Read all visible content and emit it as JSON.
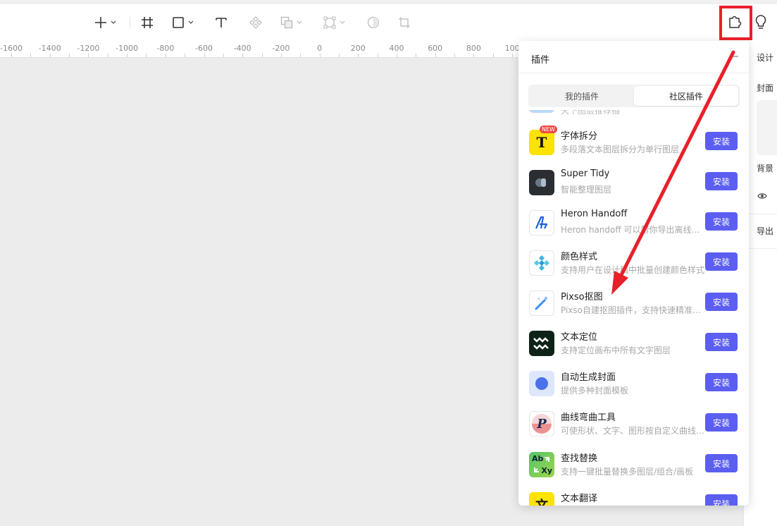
{
  "toolbar": {
    "tools": [
      "add-tool",
      "frame-tool",
      "shape-tool",
      "text-tool",
      "component-tool",
      "boolean-tool",
      "vector-tool",
      "mask-tool",
      "crop-tool"
    ],
    "plugin_icon": "puzzle-icon",
    "hint_icon": "lightbulb-icon"
  },
  "ruler": {
    "labels": [
      "-1600",
      "-1400",
      "-1200",
      "-1000",
      "-800",
      "-600",
      "-400",
      "-200",
      "0",
      "200",
      "400",
      "600",
      "800",
      "100"
    ]
  },
  "design_panel": {
    "design": "设计",
    "cover": "封面",
    "background": "背景",
    "export": "导出"
  },
  "plugin_panel": {
    "title": "插件",
    "tabs": {
      "mine": "我的插件",
      "community": "社区插件"
    },
    "partial_desc": "天下图层推荐插",
    "install_label": "安装",
    "new_badge": "NEW",
    "plugins": [
      {
        "name": "字体拆分",
        "desc": "多段落文本图层拆分为单行图层"
      },
      {
        "name": "Super Tidy",
        "desc": "智能整理图层"
      },
      {
        "name": "Heron Handoff",
        "desc": "Heron handoff 可以帮你导出离线标注"
      },
      {
        "name": "颜色样式",
        "desc": "支持用户在设计稿中批量创建颜色样式"
      },
      {
        "name": "Pixso抠图",
        "desc": "Pixso自建抠图插件，支持快速精准抠图"
      },
      {
        "name": "文本定位",
        "desc": "支持定位画布中所有文字图层"
      },
      {
        "name": "自动生成封面",
        "desc": "提供多种封面模板"
      },
      {
        "name": "曲线弯曲工具",
        "desc": "可使形状、文字、图形按自定义曲线弯曲"
      },
      {
        "name": "查找替换",
        "desc": "支持一键批量替换多图层/组合/画板"
      },
      {
        "name": "文本翻译",
        "desc": ""
      }
    ]
  },
  "icon_labels": {
    "font_split": "T",
    "find_replace_ab": "Ab",
    "find_replace_xy": "Xy",
    "curve": "P",
    "translate": "文"
  },
  "colors": {
    "accent": "#5b5ef0",
    "annotation": "#e8202a",
    "new_badge": "#f04848"
  }
}
